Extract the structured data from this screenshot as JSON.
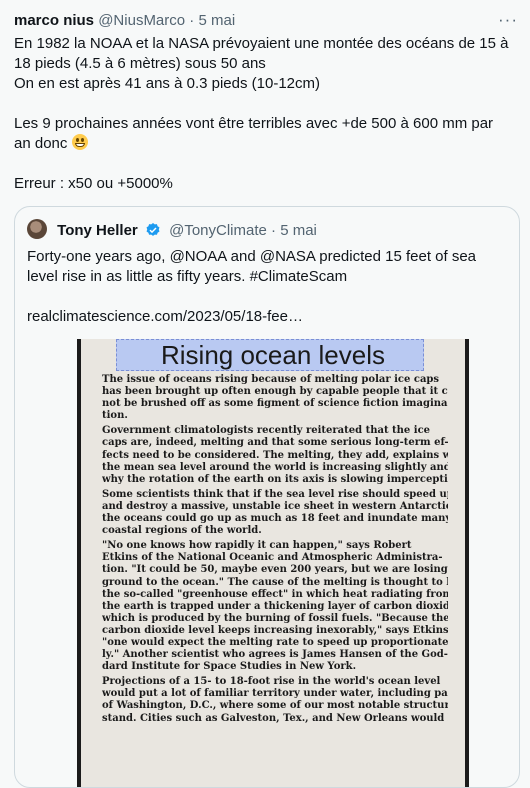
{
  "tweet": {
    "author_name": "marco nius",
    "author_handle": "@NiusMarco",
    "date": "5 mai",
    "more_label": "···",
    "lines": [
      "En 1982 la NOAA et la NASA prévoyaient une montée des océans de 15 à",
      "18 pieds (4.5 à 6 mètres) sous 50 ans",
      "On en est après 41 ans à 0.3 pieds (10-12cm)",
      "",
      "Les 9 prochaines années vont être terribles avec +de 500 à 600 mm par",
      "an donc",
      "",
      "Erreur : x50 ou +5000%"
    ],
    "emoji": "grinning-face-emoji"
  },
  "quote": {
    "author_name": "Tony Heller",
    "author_handle": "@TonyClimate",
    "date": "5 mai",
    "lines": [
      "Forty-one years ago, @NOAA and @NASA predicted 15 feet of sea",
      "level rise in as little as fifty years.  #ClimateScam",
      "",
      "realclimatescience.com/2023/05/18-fee…"
    ],
    "verified_color": "#1d9bf0"
  },
  "clipping": {
    "headline": "Rising ocean levels",
    "paragraphs": [
      [
        "The issue of oceans rising because of melting polar ice caps",
        "has been brought up often enough by capable people that it can-",
        "not be brushed off as some figment of science fiction imagina-",
        "tion."
      ],
      [
        "Government climatologists recently reiterated that the ice",
        "caps are, indeed, melting and that some serious long-term ef-",
        "fects need to be considered. The melting, they add, explains why",
        "the mean sea level around the world is increasing slightly and",
        "why the rotation of the earth on its axis is slowing imperceptibly."
      ],
      [
        "Some scientists think that if the sea level rise should speed up",
        "and destroy a massive, unstable ice sheet in western Antarctica,",
        "the oceans could go up as much as 18 feet and inundate many",
        "coastal regions of the world."
      ],
      [
        "\"No one knows how rapidly it can happen,\" says Robert",
        "Etkins of the National Oceanic and Atmospheric Administra-",
        "tion. \"It could be 50, maybe even 200 years, but we are losing",
        "ground to the ocean.\" The cause of the melting is thought to be",
        "the so-called \"greenhouse effect\" in which heat radiating from",
        "the earth is trapped under a thickening layer of carbon dioxide,",
        "which is produced by the burning of fossil fuels. \"Because the",
        "carbon dioxide level keeps increasing inexorably,\" says Etkins,",
        "\"one would expect the melting rate to speed up proportionate-",
        "ly.\" Another scientist who agrees is James Hansen of the God-",
        "dard Institute for Space Studies in New York."
      ],
      [
        "Projections of a 15- to 18-foot rise in the world's ocean level",
        "would put a lot of familiar territory under water, including parts",
        "of Washington, D.C., where some of our most notable structures",
        "stand. Cities such as Galveston, Tex., and New Orleans would be"
      ]
    ]
  }
}
